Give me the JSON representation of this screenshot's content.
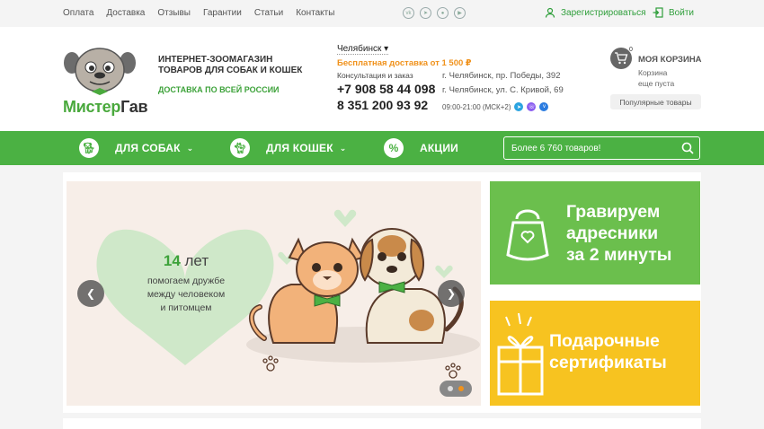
{
  "topnav": [
    "Оплата",
    "Доставка",
    "Отзывы",
    "Гарантии",
    "Статьи",
    "Контакты"
  ],
  "socials": [
    "vk-icon",
    "telegram-icon",
    "odnoklassniki-icon",
    "youtube-icon"
  ],
  "auth": {
    "register": "Зарегистрироваться",
    "login": "Войти"
  },
  "brand": {
    "logo_text_green": "Мистер",
    "logo_text_dark": "Гав",
    "tagline_1": "ИНТЕРНЕТ-ЗООМАГАЗИН",
    "tagline_2": "ТОВАРОВ ДЛЯ СОБАК И КОШЕК",
    "delivery_all": "ДОСТАВКА ПО ВСЕЙ РОССИИ"
  },
  "contacts": {
    "city": "Челябинск",
    "free_delivery": "Бесплатная доставка от 1 500 ₽",
    "consult": "Консультация и заказ",
    "phone1": "+7 908 58 44 098",
    "phone2": "8 351 200 93 92",
    "address1": "г. Челябинск, пр. Победы, 392",
    "address2": "г. Челябинск, ул. С. Кривой, 69",
    "hours": "09:00-21:00 (МСК+2)"
  },
  "cart": {
    "count": "0",
    "title": "МОЯ КОРЗИНА",
    "line1": "Корзина",
    "line2": "еще пуста",
    "popular": "Популярные товары"
  },
  "nav": {
    "dogs": "ДЛЯ СОБАК",
    "cats": "ДЛЯ КОШЕК",
    "sales": "АКЦИИ",
    "sales_icon": "%",
    "search_placeholder": "Более 6 760 товаров!"
  },
  "slide": {
    "years_num": "14",
    "years_word": "лет",
    "text_1": "помогаем дружбе",
    "text_2": "между человеком",
    "text_3": "и питомцем"
  },
  "banners": {
    "green_1": "Гравируем",
    "green_2": "адресники",
    "green_3": "за 2 минуты",
    "yellow_1": "Подарочные",
    "yellow_2": "сертификаты"
  },
  "colors": {
    "brand_green": "#4bb143",
    "accent_orange": "#f0921c",
    "banner_green": "#6bbf4d",
    "banner_yellow": "#f7c320"
  }
}
